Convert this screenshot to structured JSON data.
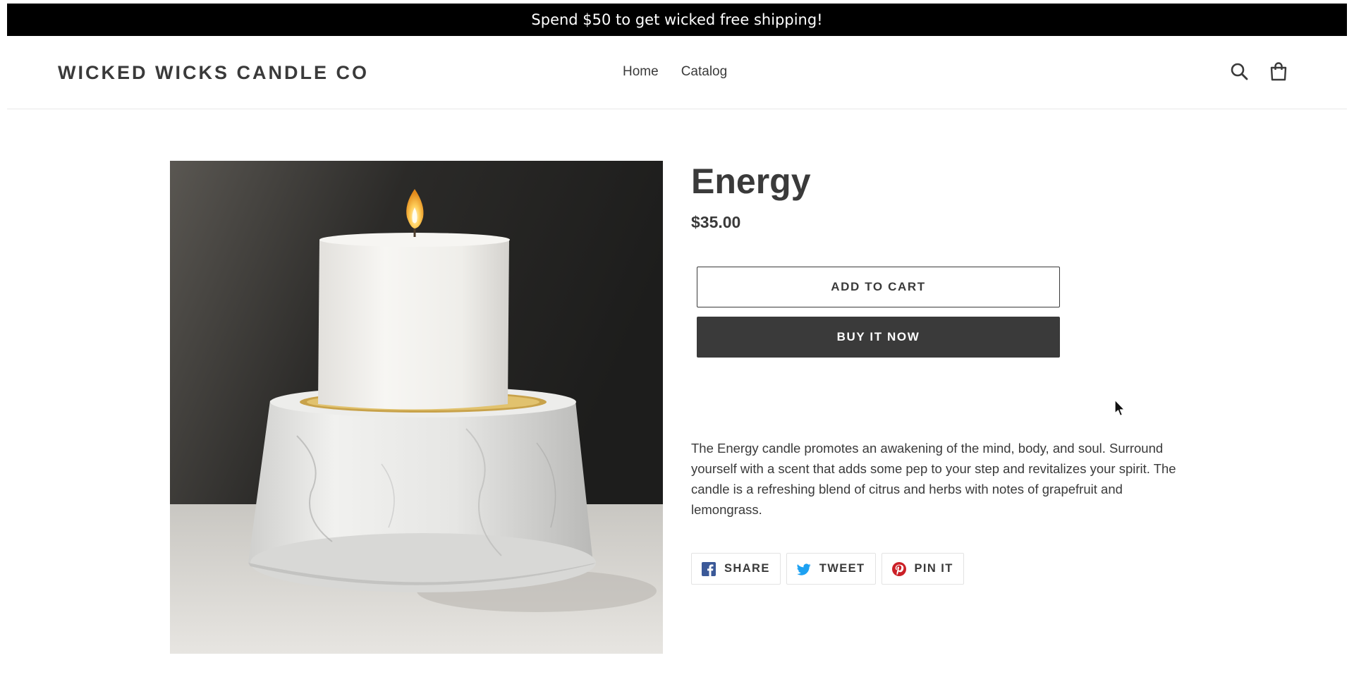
{
  "announcement": {
    "text": "Spend $50 to get wicked free shipping!"
  },
  "header": {
    "logo": "WICKED WICKS CANDLE CO",
    "nav": [
      {
        "label": "Home"
      },
      {
        "label": "Catalog"
      }
    ],
    "icons": {
      "search": "search-icon",
      "cart": "cart-icon"
    }
  },
  "product": {
    "title": "Energy",
    "price": "$35.00",
    "add_to_cart": "ADD TO CART",
    "buy_now": "BUY IT NOW",
    "description": "The Energy candle promotes an awakening of the mind, body, and soul. Surround yourself with a scent that adds some pep to your step and revitalizes your spirit. The candle is a refreshing blend of citrus and herbs with notes of grapefruit and lemongrass.",
    "image_icon": "candle-photo"
  },
  "share": [
    {
      "label": "SHARE",
      "icon": "facebook-icon",
      "color": "#3b5998"
    },
    {
      "label": "TWEET",
      "icon": "twitter-icon",
      "color": "#1da1f2"
    },
    {
      "label": "PIN IT",
      "icon": "pinterest-icon",
      "color": "#cb2027"
    }
  ],
  "colors": {
    "text": "#3a3a3a",
    "announcement_bg": "#000000",
    "buy_bg": "#3a3a3a"
  }
}
